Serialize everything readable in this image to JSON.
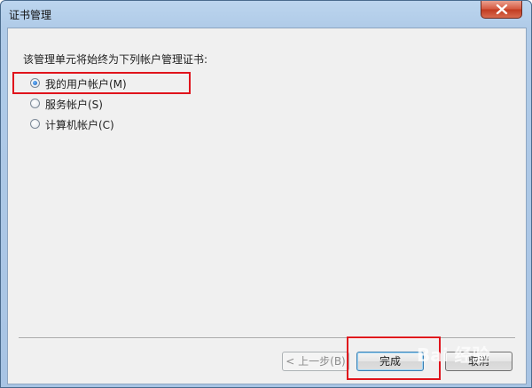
{
  "window": {
    "title": "证书管理"
  },
  "dialog": {
    "prompt": "该管理单元将始终为下列帐户管理证书:",
    "options": [
      {
        "label": "我的用户帐户(M)",
        "checked": true
      },
      {
        "label": "服务帐户(S)",
        "checked": false
      },
      {
        "label": "计算机帐户(C)",
        "checked": false
      }
    ]
  },
  "buttons": {
    "back": "< 上一步(B)",
    "finish": "完成",
    "cancel": "取消"
  },
  "watermark": "Bai 经验",
  "colors": {
    "highlight_box": "#e0141c",
    "radio_dot": "#1d5fb3"
  }
}
